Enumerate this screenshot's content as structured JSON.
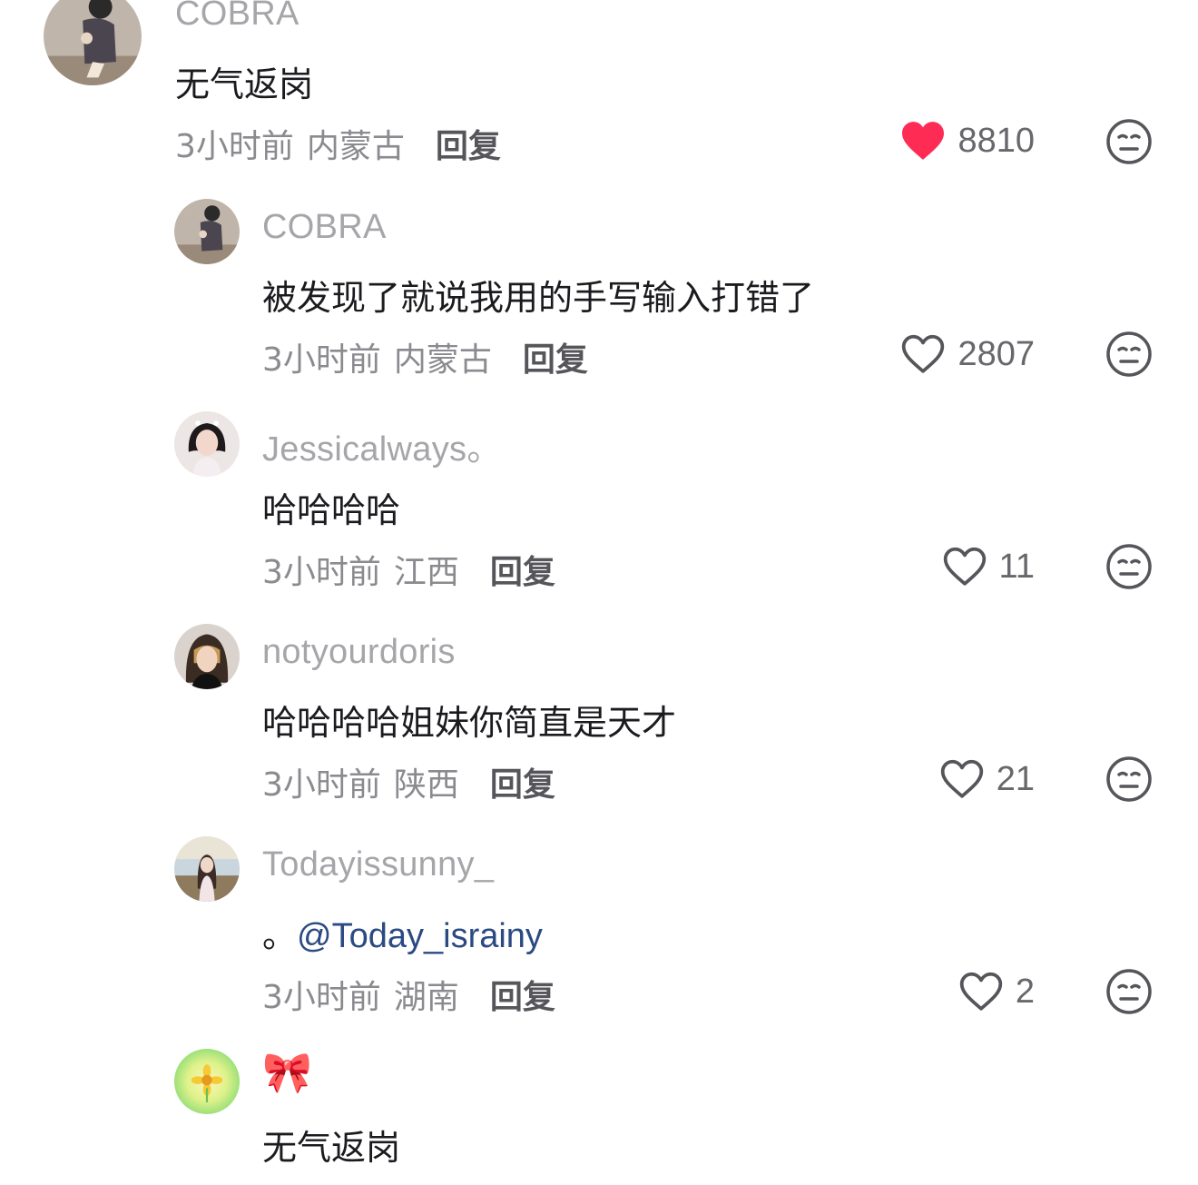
{
  "comments": [
    {
      "username": "COBRA",
      "text": "无气返岗",
      "time": "3小时前",
      "location": "内蒙古",
      "reply_label": "回复",
      "likes": "8810",
      "liked": true,
      "avatar_icon": "avatar-person-sitting"
    },
    {
      "username": "COBRA",
      "text": "被发现了就说我用的手写输入打错了",
      "time": "3小时前",
      "location": "内蒙古",
      "reply_label": "回复",
      "likes": "2807",
      "liked": false,
      "avatar_icon": "avatar-person-sitting"
    },
    {
      "username": "Jessicalways。",
      "text": "哈哈哈哈",
      "time": "3小时前",
      "location": "江西",
      "reply_label": "回复",
      "likes": "11",
      "liked": false,
      "avatar_icon": "avatar-girl-portrait"
    },
    {
      "username": "notyourdoris",
      "text": "哈哈哈哈姐妹你简直是天才",
      "time": "3小时前",
      "location": "陕西",
      "reply_label": "回复",
      "likes": "21",
      "liked": false,
      "avatar_icon": "avatar-girl-portrait"
    },
    {
      "username": "Todayissunny_",
      "text_prefix": "。",
      "mention": "@Today_israiny",
      "time": "3小时前",
      "location": "湖南",
      "reply_label": "回复",
      "likes": "2",
      "liked": false,
      "avatar_icon": "avatar-girl-outdoor"
    },
    {
      "username": "🎀",
      "text": "无气返岗",
      "avatar_icon": "avatar-sunflower"
    }
  ],
  "colors": {
    "liked_heart": "#fe2c55",
    "mention": "#2b4a83",
    "username": "#a6a6aa",
    "meta": "#8a8a8f"
  },
  "icons": {
    "like": "heart-icon",
    "dislike": "meh-face-icon"
  }
}
